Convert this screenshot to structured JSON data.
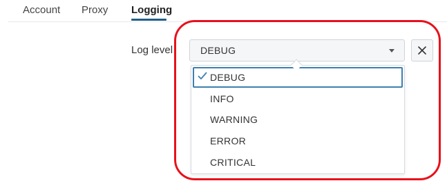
{
  "tabs": [
    {
      "label": "Account",
      "active": false
    },
    {
      "label": "Proxy",
      "active": false
    },
    {
      "label": "Logging",
      "active": true
    }
  ],
  "form": {
    "log_level_label": "Log level",
    "selected_value": "DEBUG",
    "caret_icon": "caret-down-icon",
    "clear_icon": "close-icon"
  },
  "dropdown": {
    "options": [
      {
        "label": "DEBUG",
        "selected": true
      },
      {
        "label": "INFO",
        "selected": false
      },
      {
        "label": "WARNING",
        "selected": false
      },
      {
        "label": "ERROR",
        "selected": false
      },
      {
        "label": "CRITICAL",
        "selected": false
      }
    ]
  },
  "colors": {
    "active_tab_underline": "#1f5f85",
    "selected_option_border": "#3d7fae",
    "check_mark": "#3d7fae",
    "highlight_ring": "#e8101a"
  }
}
